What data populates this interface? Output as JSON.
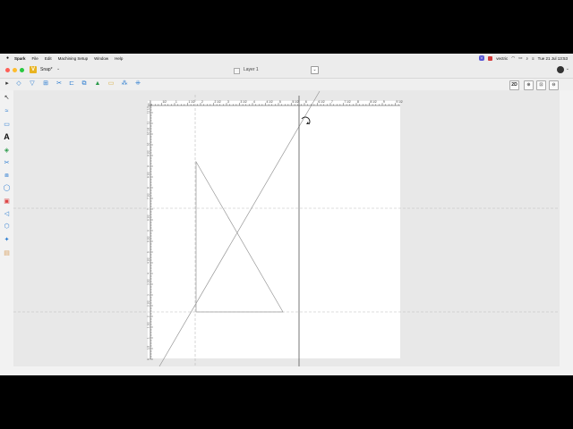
{
  "menubar": {
    "apple": "",
    "items": [
      "Spark",
      "File",
      "Edit",
      "Machining Setup",
      "Window",
      "Help"
    ],
    "badge": "V",
    "vectric": "vectric",
    "clock": "Tue 21 Jul  13:53"
  },
  "window": {
    "app_letter": "V",
    "file_name": "Snap*",
    "file_chevron": "⌄",
    "layer_name": "Layer 1",
    "layer_dropdown": "⌄",
    "user_chevron": "⌄",
    "traffic_colors": [
      "#fe5f57",
      "#febc2e",
      "#28c840"
    ]
  },
  "toolbar": {
    "view_2d": "2D",
    "zoom_in": "⊕",
    "zoom_extent": "⊡",
    "zoom_out": "⊖"
  },
  "left_tools": {
    "text_tool": "A"
  },
  "ruler": {
    "top_labels": [
      "0",
      "1/2",
      "1",
      "1 1/2",
      "2",
      "2 1/2",
      "3",
      "3 1/2",
      "4",
      "4 1/2",
      "5",
      "5 1/2",
      "6",
      "6 1/2",
      "7",
      "7 1/2",
      "8",
      "8 1/2",
      "9",
      "9 1/2"
    ],
    "left_labels": [
      "12",
      "11 1/2",
      "11",
      "10 1/2",
      "10",
      "9 1/2",
      "9",
      "8 1/2",
      "8",
      "7 1/2",
      "7",
      "6 1/2",
      "6",
      "5 1/2",
      "5",
      "4 1/2",
      "4",
      "3 1/2",
      "3",
      "2 1/2",
      "2",
      "1 1/2",
      "1",
      "1/2",
      "0"
    ]
  },
  "help": "?"
}
